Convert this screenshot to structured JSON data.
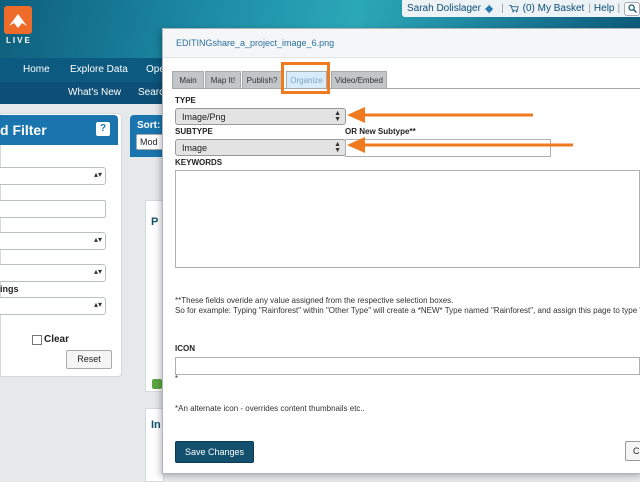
{
  "header": {
    "logo_text": "LIVE",
    "user_name": "Sarah Dolislager",
    "basket": "(0) My Basket",
    "help": "Help"
  },
  "nav": {
    "primary": [
      "Home",
      "Explore Data",
      "Ope"
    ],
    "secondary": [
      "What's New",
      "Searc"
    ]
  },
  "filter": {
    "title": "d Filter",
    "help": "?",
    "partial_label": "ings",
    "clear_label": "Clear",
    "reset_label": "Reset"
  },
  "sort": {
    "title": "Sort:",
    "value": "Mod",
    "card1_letter": "P",
    "card2_letter": "In"
  },
  "modal": {
    "title": "EDITINGshare_a_project_image_6.png",
    "tabs": [
      "Main",
      "Map It!",
      "Publish?",
      "Organize",
      "Video/Embed"
    ],
    "active_tab": "Organize",
    "type_label": "TYPE",
    "type_value": "Image/Png",
    "subtype_label": "SUBTYPE",
    "subtype_value": "Image",
    "new_subtype_label": "OR New Subtype**",
    "keywords_label": "KEYWORDS",
    "note_line1": "**These fields overide any value assigned from the respective selection boxes.",
    "note_line2": "So for example: Typing \"Rainforest\" within \"Other Type\" will create a *NEW* Type named \"Rainforest\", and assign this page to type \"Ra",
    "icon_label": "ICON",
    "icon_star": "*",
    "icon_note": "*An alternate icon - overrides content thumbnails etc..",
    "save_label": "Save Changes",
    "cancel_label": "C"
  },
  "colors": {
    "accent_orange": "#f07a1f",
    "nav_blue": "#0c5a80",
    "save_button": "#12506e"
  }
}
